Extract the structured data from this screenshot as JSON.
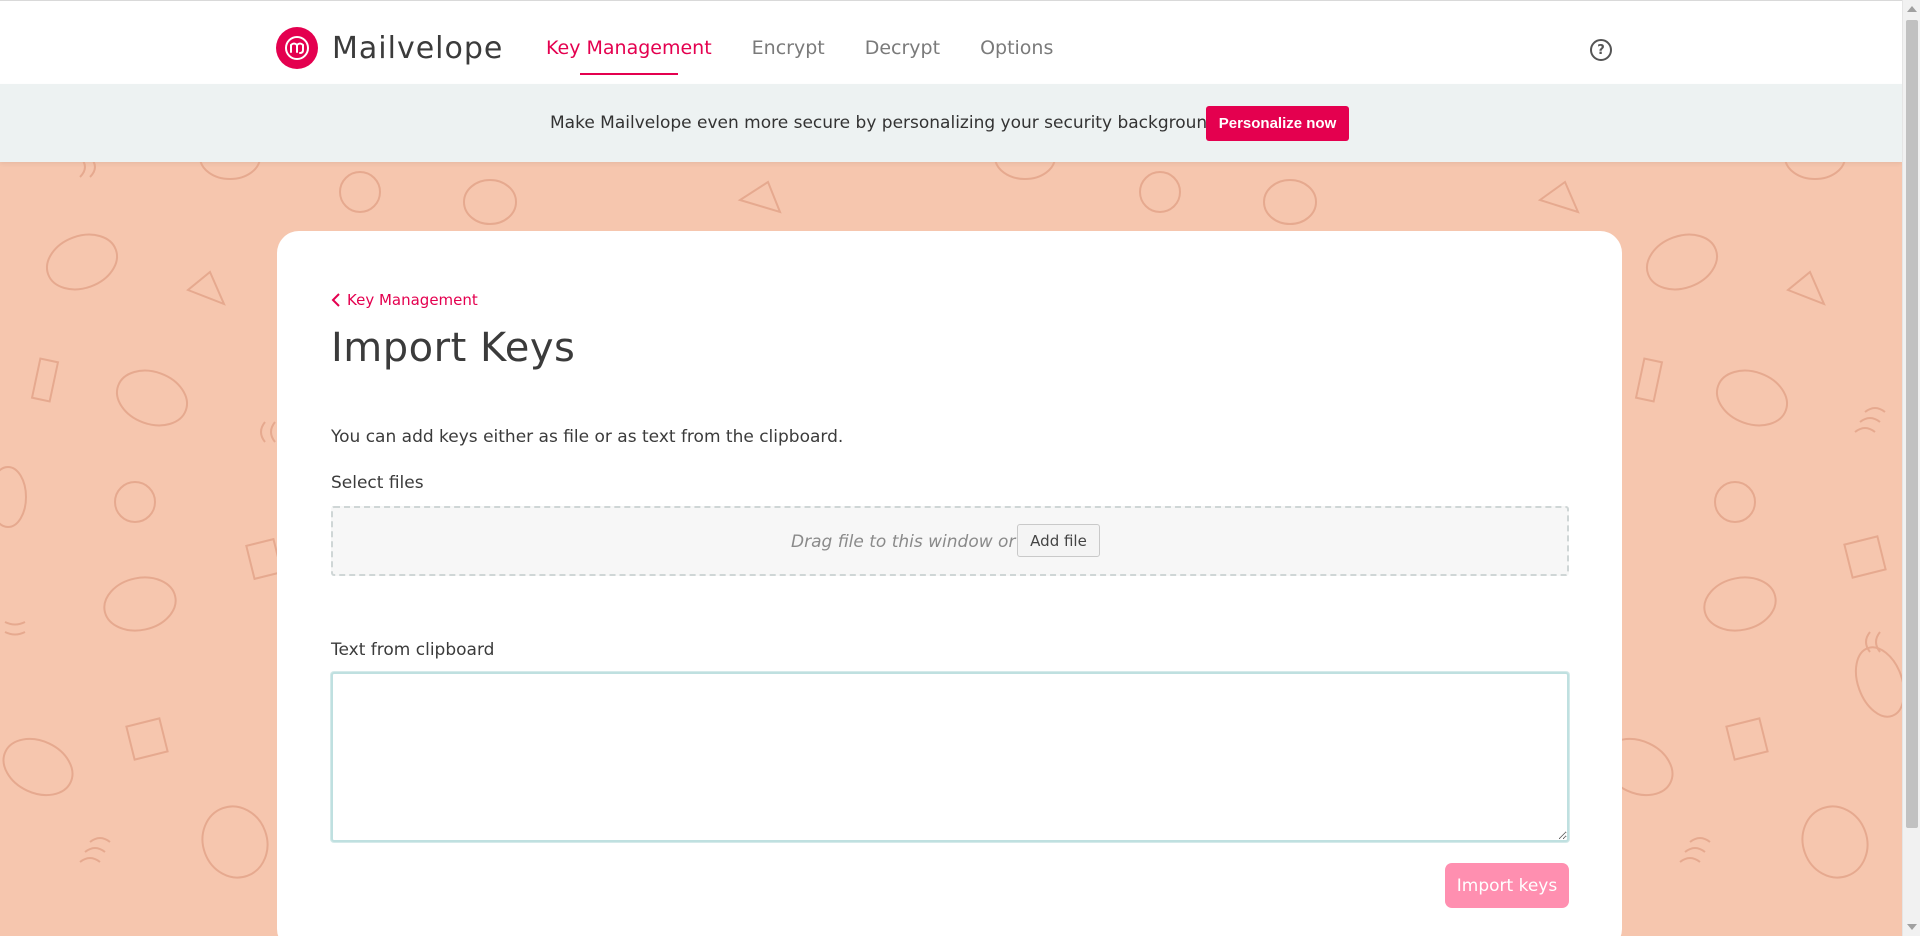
{
  "brand": {
    "name": "Mailvelope",
    "logo_icon": "mailvelope-logo-icon",
    "accent": "#e4004f"
  },
  "nav": {
    "items": [
      {
        "label": "Key Management",
        "active": true
      },
      {
        "label": "Encrypt",
        "active": false
      },
      {
        "label": "Decrypt",
        "active": false
      },
      {
        "label": "Options",
        "active": false
      }
    ],
    "help_icon": "help-circle-icon"
  },
  "banner": {
    "text": "Make Mailvelope even more secure by personalizing your security background.",
    "button_label": "Personalize now"
  },
  "main": {
    "breadcrumb": "Key Management",
    "title": "Import Keys",
    "intro": "You can add keys either as file or as text from the clipboard.",
    "files_label": "Select files",
    "drop_text": "Drag file to this window or",
    "add_file_label": "Add file",
    "clipboard_label": "Text from clipboard",
    "clipboard_value": "",
    "import_label": "Import keys"
  },
  "colors": {
    "background": "#f6c6ae",
    "pattern": "#e3a58a",
    "import_button": "#ff8fb0"
  }
}
